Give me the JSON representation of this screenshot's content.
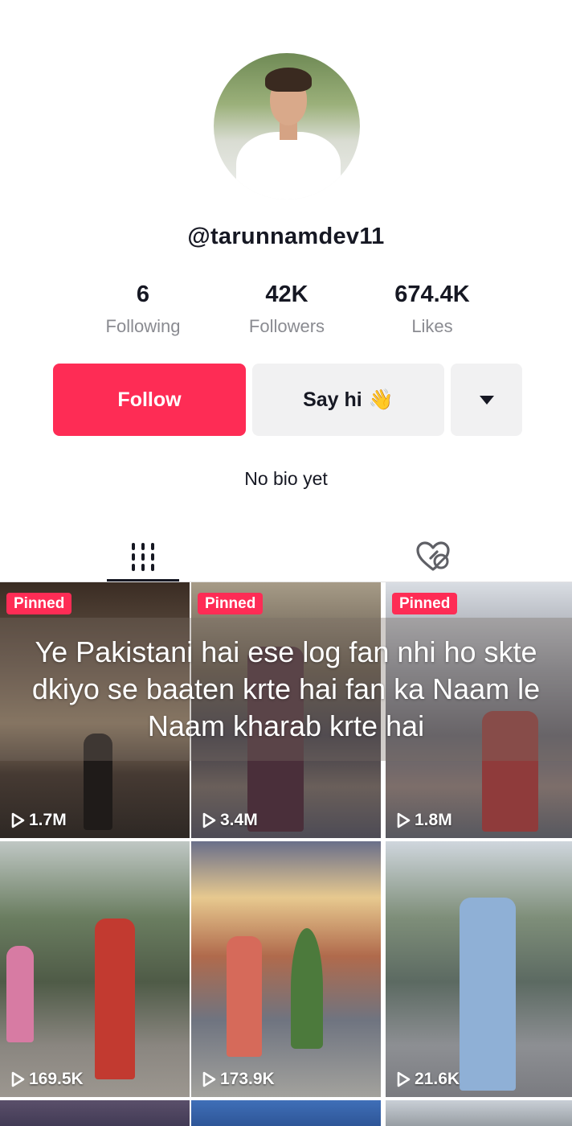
{
  "profile": {
    "username": "@tarunnamdev11",
    "bio": "No bio yet"
  },
  "stats": [
    {
      "value": "6",
      "label": "Following"
    },
    {
      "value": "42K",
      "label": "Followers"
    },
    {
      "value": "674.4K",
      "label": "Likes"
    }
  ],
  "actions": {
    "follow_label": "Follow",
    "say_hi_label": "Say hi",
    "say_hi_emoji": "👋",
    "more_icon": "caret-down-icon"
  },
  "tabs": [
    {
      "name": "videos",
      "icon": "grid-icon",
      "active": true
    },
    {
      "name": "liked",
      "icon": "liked-hidden-icon",
      "active": false
    }
  ],
  "overlay_caption": [
    "Ye Pakistani hai ese log fan nhi ho skte",
    "dkiyo se baaten krte hai fan ka Naam le",
    "Naam kharab krte hai"
  ],
  "videos": [
    {
      "pinned_label": "Pinned",
      "views": "1.7M"
    },
    {
      "pinned_label": "Pinned",
      "views": "3.4M"
    },
    {
      "pinned_label": "Pinned",
      "views": "1.8M"
    },
    {
      "pinned_label": "",
      "views": "169.5K"
    },
    {
      "pinned_label": "",
      "views": "173.9K"
    },
    {
      "pinned_label": "",
      "views": "21.6K"
    }
  ],
  "colors": {
    "accent": "#fe2c55",
    "secondary_button": "#f1f1f2",
    "text_primary": "#161823",
    "text_muted": "#8a8b91"
  }
}
